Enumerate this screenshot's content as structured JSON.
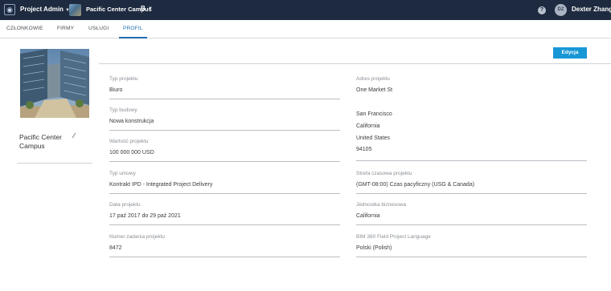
{
  "topbar": {
    "app_name": "Project Admin",
    "app_icon": "hub-icon",
    "project_name": "Pacific Center Campus",
    "project_badge": "B",
    "help_glyph": "?",
    "user_initials": "DZ",
    "user_name": "Dexter Zhang"
  },
  "tabs": [
    {
      "label": "CZŁONKOWIE"
    },
    {
      "label": "FIRMY"
    },
    {
      "label": "USŁUGI"
    },
    {
      "label": "PROFIL"
    }
  ],
  "profile": {
    "title": "Pacific Center Campus",
    "edit_label": "Edycja"
  },
  "left_fields": [
    {
      "label": "Typ projektu",
      "value": "Biuro"
    },
    {
      "label": "Typ budowy",
      "value": "Nowa konstrukcja"
    },
    {
      "label": "Wartość projektu",
      "value": "100 000 000 USD"
    },
    {
      "label": "Typ umowy",
      "value": "Kontrakt IPD - Integrated Project Delivery"
    },
    {
      "label": "Data projektu",
      "value": "17 paź 2017 do 29 paź 2021"
    },
    {
      "label": "Numer zadania projektu",
      "value": "8472"
    }
  ],
  "address": {
    "label": "Adres projektu",
    "street": "One Market St",
    "city": "San Francisco",
    "state": "California",
    "country": "United States",
    "zip": "94105"
  },
  "right_fields": [
    {
      "label": "Strefa czasowa projektu",
      "value": "(GMT-08:00) Czas pacyficzny (USG & Canada)"
    },
    {
      "label": "Jednostka biznesowa",
      "value": "California"
    },
    {
      "label": "BIM 360 Field Project Language",
      "value": "Polski (Polish)"
    }
  ],
  "colors": {
    "topbar": "#1e2a3f",
    "accent": "#1797d6",
    "active_tab": "#1f6fb2"
  }
}
